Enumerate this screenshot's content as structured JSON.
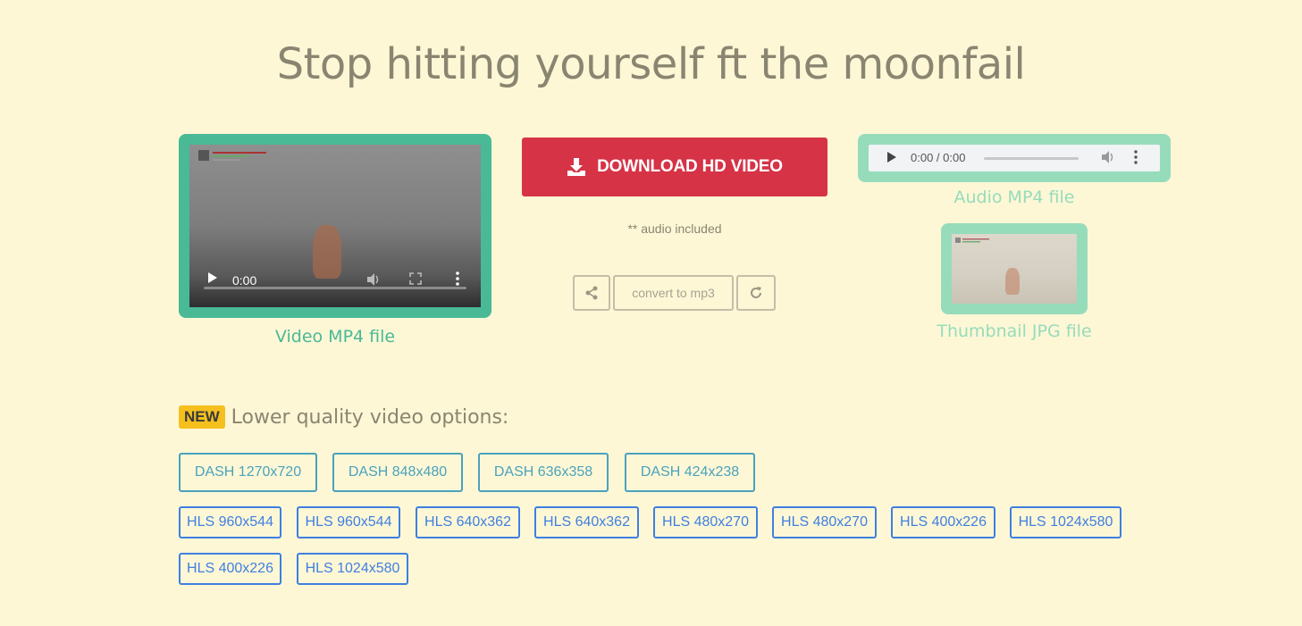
{
  "page": {
    "title": "Stop hitting yourself ft the moonfail"
  },
  "video": {
    "time": "0:00",
    "label": "Video MP4 file"
  },
  "download": {
    "label": "DOWNLOAD HD VIDEO",
    "note": "** audio included"
  },
  "tools": {
    "convert_label": "convert to mp3"
  },
  "audio": {
    "time": "0:00 / 0:00",
    "label": "Audio MP4 file"
  },
  "thumbnail": {
    "label": "Thumbnail JPG file"
  },
  "lower_quality": {
    "badge": "NEW",
    "title": "Lower quality video options:",
    "dash": [
      "DASH 1270x720",
      "DASH 848x480",
      "DASH 636x358",
      "DASH 424x238"
    ],
    "hls": [
      "HLS 960x544",
      "HLS 960x544",
      "HLS 640x362",
      "HLS 640x362",
      "HLS 480x270",
      "HLS 480x270",
      "HLS 400x226",
      "HLS 1024x580",
      "HLS 400x226",
      "HLS 1024x580"
    ]
  },
  "colors": {
    "background": "#fdf7d6",
    "video_accent": "#49b996",
    "audio_accent": "#96dcbb",
    "download": "#d63347",
    "badge": "#f5c01e",
    "dash": "#4aa2bd",
    "hls": "#3f7fe0"
  },
  "icons": [
    "download-icon",
    "share-icon",
    "refresh-icon",
    "play-icon",
    "volume-icon",
    "fullscreen-icon",
    "more-icon"
  ]
}
